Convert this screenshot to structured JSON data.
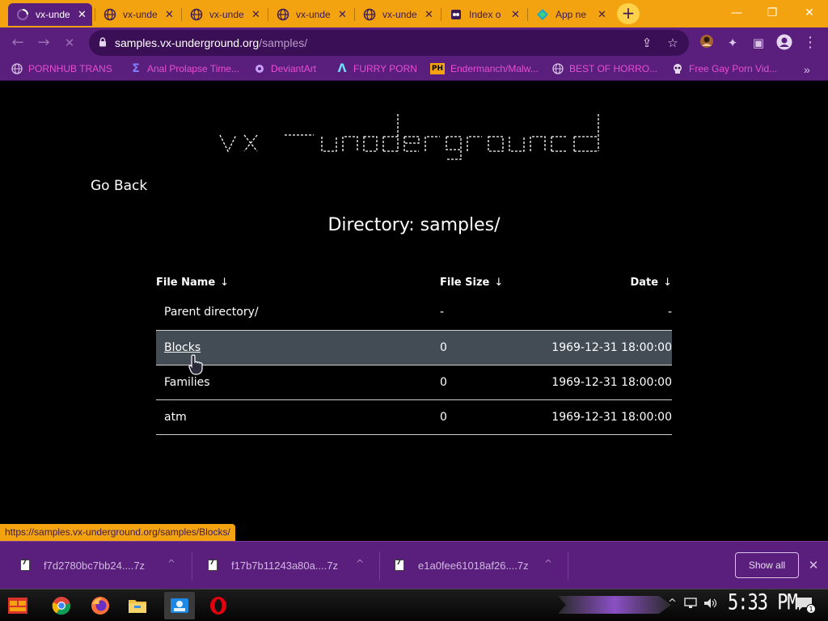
{
  "tabs": [
    {
      "title": "vx-unde",
      "active": true,
      "close": "✕"
    },
    {
      "title": "vx-unde",
      "active": false,
      "close": "✕"
    },
    {
      "title": "vx-unde",
      "active": false,
      "close": "✕"
    },
    {
      "title": "vx-unde",
      "active": false,
      "close": "✕"
    },
    {
      "title": "vx-unde",
      "active": false,
      "close": "✕"
    },
    {
      "title": "Index o",
      "active": false,
      "close": "✕"
    },
    {
      "title": "App ne",
      "active": false,
      "close": "✕"
    }
  ],
  "new_tab_label": "+",
  "window_controls": {
    "minimize": "—",
    "maximize": "❐",
    "close": "✕"
  },
  "toolbar": {
    "back": "←",
    "forward": "→",
    "reload": "✕",
    "url_host": "samples.vx-underground.org",
    "url_path": "/samples/",
    "share": "⇪",
    "star": "☆",
    "extensions": "✦",
    "sidepanel": "▣",
    "menu": "⋮"
  },
  "bookmarks": [
    {
      "label": "PORNHUB TRANS"
    },
    {
      "label": "Anal Prolapse Time..."
    },
    {
      "label": "DeviantArt"
    },
    {
      "label": "FURRY PORN"
    },
    {
      "label": "Endermanch/Malw..."
    },
    {
      "label": "BEST OF HORRO..."
    },
    {
      "label": "Free Gay Porn Vid..."
    }
  ],
  "bookmarks_overflow": "»",
  "page": {
    "logo_text": "vx-underground",
    "go_back": "Go Back",
    "directory_label": "Directory:",
    "directory_name": "samples/",
    "columns": {
      "name": "File Name",
      "size": "File Size",
      "date": "Date",
      "sort_arrow": "↓"
    },
    "rows": [
      {
        "name": "Parent directory/",
        "size": "-",
        "date": "-"
      },
      {
        "name": "Blocks",
        "size": "0",
        "date": "1969-12-31 18:00:00"
      },
      {
        "name": "Families",
        "size": "0",
        "date": "1969-12-31 18:00:00"
      },
      {
        "name": "atm",
        "size": "0",
        "date": "1969-12-31 18:00:00"
      }
    ],
    "status_url": "https://samples.vx-underground.org/samples/Blocks/"
  },
  "downloads": [
    {
      "file": "f7d2780bc7bb24....7z",
      "chevron": "^"
    },
    {
      "file": "f17b7b11243a80a....7z",
      "chevron": "^"
    },
    {
      "file": "e1a0fee61018af26....7z",
      "chevron": "^"
    }
  ],
  "show_all": "Show all",
  "shelf_close": "✕",
  "taskbar": {
    "clock": "5:33 PM",
    "tray_up": "^",
    "notification_count": "1"
  },
  "colors": {
    "accent_orange": "#f3a30f",
    "theme_purple": "#5a1f7c",
    "omnibox": "#3b0f56",
    "bookmark_text": "#e84dd6",
    "hover_row": "#434b55"
  }
}
